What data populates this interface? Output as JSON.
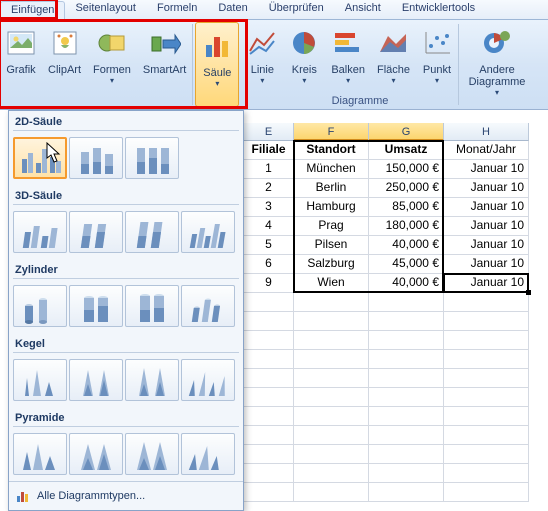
{
  "tabs": [
    "Einfügen",
    "Seitenlayout",
    "Formeln",
    "Daten",
    "Überprüfen",
    "Ansicht",
    "Entwicklertools"
  ],
  "active_tab": 0,
  "ribbon": {
    "illust": [
      "Grafik",
      "ClipArt",
      "Formen",
      "SmartArt"
    ],
    "charts": [
      "Säule",
      "Linie",
      "Kreis",
      "Balken",
      "Fläche",
      "Punkt",
      "Andere Diagramme"
    ],
    "group_label": "Diagramme"
  },
  "dropdown": {
    "sections": [
      "2D-Säule",
      "3D-Säule",
      "Zylinder",
      "Kegel",
      "Pyramide"
    ],
    "footer": "Alle Diagrammtypen..."
  },
  "sheet": {
    "visible_cols": [
      "E",
      "F",
      "G",
      "H"
    ],
    "selected_cols": [
      "F",
      "G"
    ],
    "headers": {
      "E": "Filiale",
      "F": "Standort",
      "G": "Umsatz",
      "H": "Monat/Jahr"
    },
    "rows": [
      {
        "E": "1",
        "F": "München",
        "G": "150,000 €",
        "H": "Januar 10"
      },
      {
        "E": "2",
        "F": "Berlin",
        "G": "250,000 €",
        "H": "Januar 10"
      },
      {
        "E": "3",
        "F": "Hamburg",
        "G": "85,000 €",
        "H": "Januar 10"
      },
      {
        "E": "4",
        "F": "Prag",
        "G": "180,000 €",
        "H": "Januar 10"
      },
      {
        "E": "5",
        "F": "Pilsen",
        "G": "40,000 €",
        "H": "Januar 10"
      },
      {
        "E": "6",
        "F": "Salzburg",
        "G": "45,000 €",
        "H": "Januar 10"
      },
      {
        "E": "9",
        "F": "Wien",
        "G": "40,000 €",
        "H": "Januar 10"
      }
    ]
  },
  "chart_data": {
    "type": "bar",
    "title": "",
    "xlabel": "Standort",
    "ylabel": "Umsatz",
    "categories": [
      "München",
      "Berlin",
      "Hamburg",
      "Prag",
      "Pilsen",
      "Salzburg",
      "Wien"
    ],
    "values": [
      150000,
      250000,
      85000,
      180000,
      40000,
      45000,
      40000
    ],
    "currency": "€"
  }
}
